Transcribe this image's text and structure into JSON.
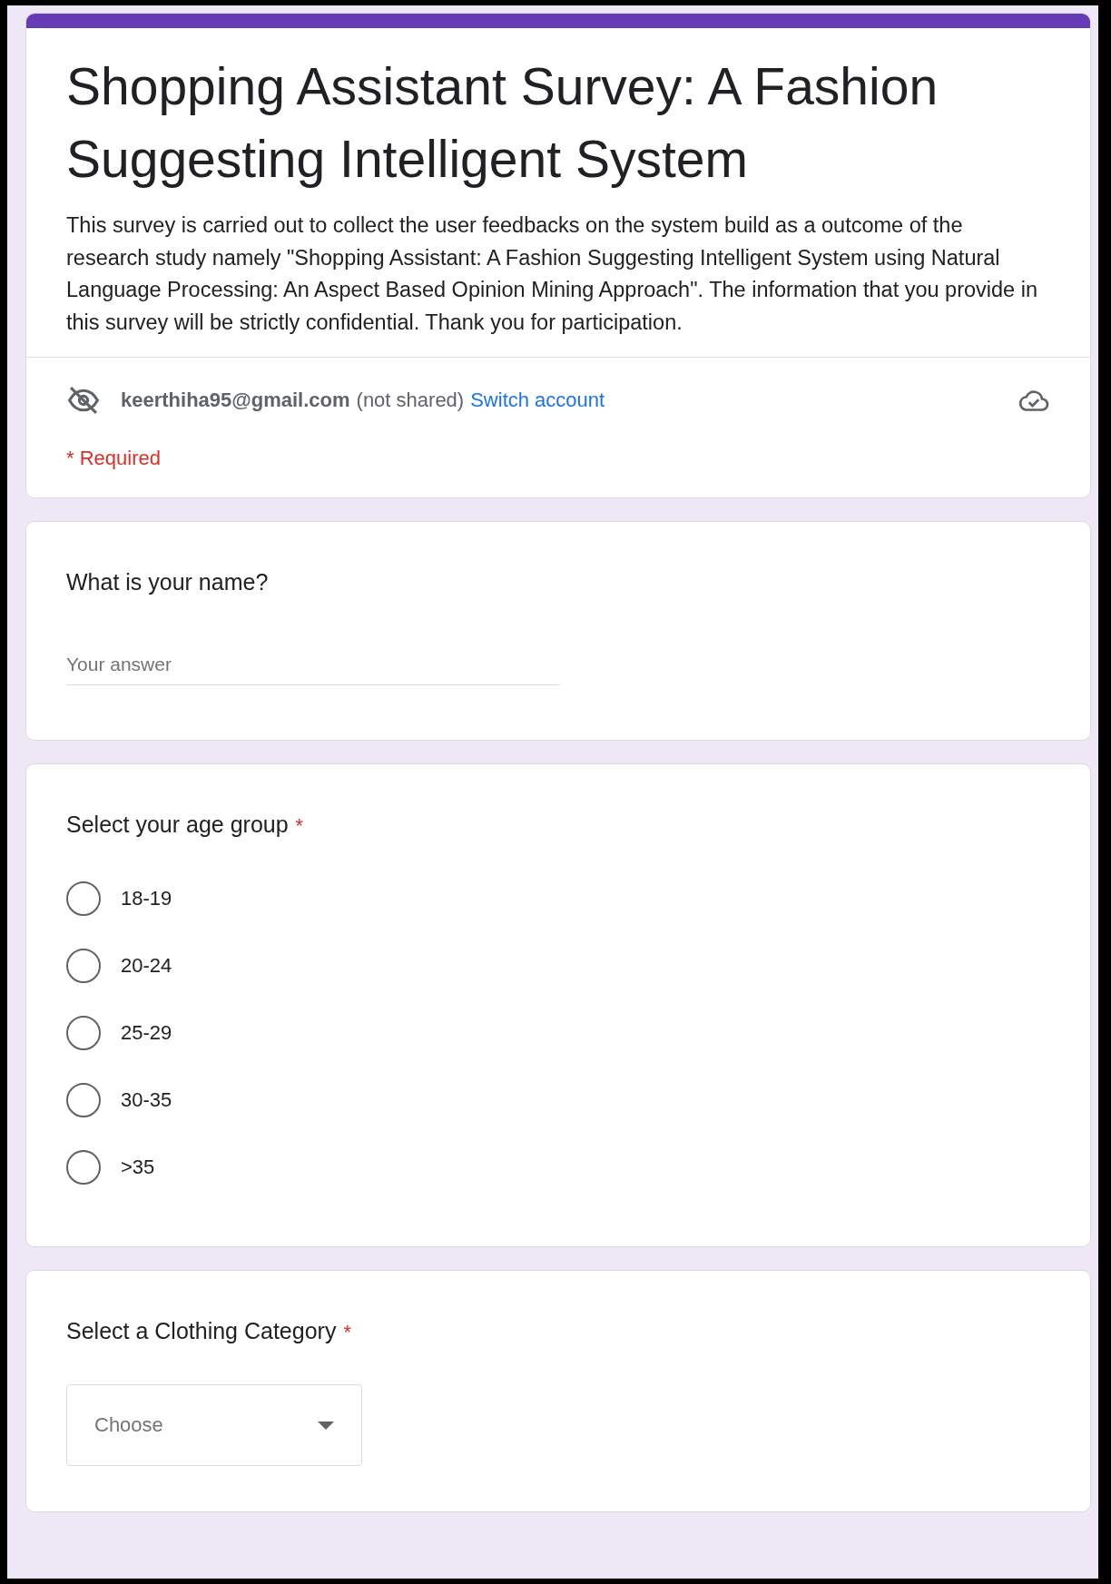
{
  "form": {
    "title": "Shopping Assistant Survey: A Fashion Suggesting Intelligent System",
    "description": "This survey is carried out to collect the user feedbacks on the system build as a outcome of the research study namely \"Shopping Assistant: A Fashion Suggesting Intelligent System using Natural Language Processing: An Aspect Based Opinion Mining Approach\". The information that you provide in this survey will be strictly confidential. Thank you for participation.",
    "account": {
      "email": "keerthiha95@gmail.com",
      "note": "(not shared)",
      "switch_link": "Switch account"
    },
    "required_note": "* Required"
  },
  "questions": [
    {
      "kind": "text",
      "title": "What is your name?",
      "placeholder": "Your answer"
    },
    {
      "kind": "radio",
      "title": "Select your age group",
      "required_mark": "*",
      "options": [
        {
          "label": "18-19",
          "selected": false
        },
        {
          "label": "20-24",
          "selected": false
        },
        {
          "label": "25-29",
          "selected": false
        },
        {
          "label": "30-35",
          "selected": false
        },
        {
          "label": ">35",
          "selected": false
        }
      ]
    },
    {
      "kind": "dropdown",
      "title": "Select a Clothing Category",
      "required_mark": "*",
      "placeholder": "Choose"
    }
  ]
}
